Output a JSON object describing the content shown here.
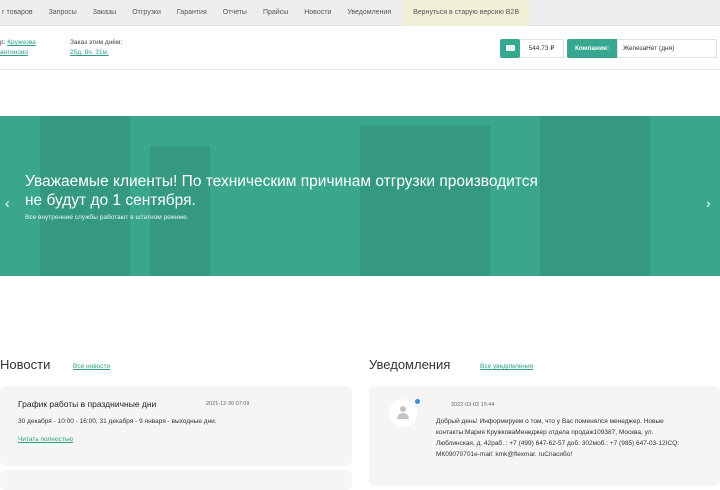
{
  "nav": {
    "items": [
      "г товаров",
      "Запросы",
      "Заказы",
      "Отгрузки",
      "Гарантия",
      "Отчеты",
      "Прайсы",
      "Новости",
      "Уведомления"
    ],
    "old_version": "Вернуться в старую версию B2B"
  },
  "header": {
    "address_prefix": "р: ",
    "address_link1": "Кружкова",
    "address_link2": "антиново",
    "order_label": "Заказ этим днём:",
    "order_value": "25д. 8ч. 31м.",
    "balance": "544.73 ₽",
    "company_label": "Компания:",
    "company_value": "ЖелезаНет (дня)"
  },
  "banner": {
    "title": "Уважаемые клиенты! По техническим причинам отгрузки производится не будут до 1 сентября.",
    "subtitle": "Все внутренние службы работают в штатном режиме.",
    "prev": "‹",
    "next": "›"
  },
  "news": {
    "title": "Новости",
    "all_link": "Все новости",
    "items": [
      {
        "title": "График работы в праздничные дни",
        "date": "2021-12-30 07:09",
        "text": "30 декабря - 10:00 - 16:00, 31 декабря - 9 января - выходные дни.",
        "more": "Читать полностью"
      }
    ]
  },
  "notifications": {
    "title": "Уведомления",
    "all_link": "Все уведомления",
    "items": [
      {
        "date": "2022-03-02 15:44",
        "text": "Добрый день! Информируем о том, что у Вас поменялся менеджер. Новые контакты:Мария КружковаМенеджер отдела продаж109387, Москва, ул. Люблинская, д. 42раб. : +7 (499) 647-62-57 доб. 302моб.: +7 (985) 647-03-12ICQ: МК09070701e-mail: kmk@flexmar. ruСпасибо!"
      }
    ]
  },
  "colors": {
    "accent": "#37a88f",
    "banner": "#3aa68c",
    "link": "#2f9c86"
  }
}
